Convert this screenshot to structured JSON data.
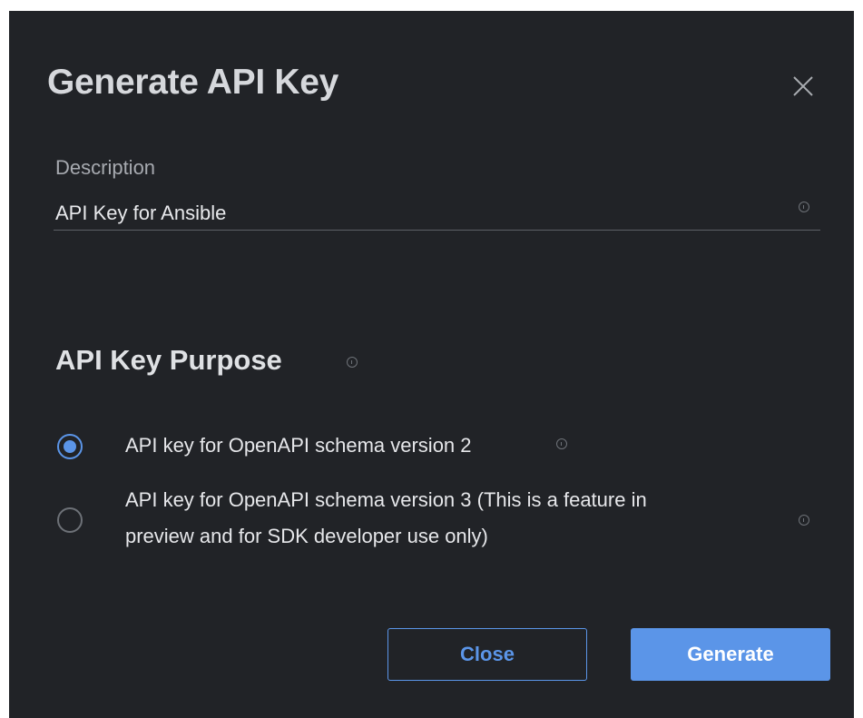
{
  "dialog": {
    "title": "Generate API Key",
    "close_icon": "close-icon"
  },
  "description": {
    "label": "Description",
    "value": "API Key for Ansible",
    "info_icon": "info-icon"
  },
  "purpose": {
    "title": "API Key Purpose",
    "info_icon": "info-icon",
    "options": [
      {
        "label": "API key for OpenAPI schema version 2",
        "selected": true,
        "info_icon": "info-icon"
      },
      {
        "label_line1": "API key for OpenAPI schema version 3 (This is a feature in",
        "label_line2": "preview and for SDK developer use only)",
        "selected": false,
        "info_icon": "info-icon"
      }
    ]
  },
  "buttons": {
    "close_label": "Close",
    "generate_label": "Generate"
  },
  "colors": {
    "background": "#212327",
    "accent": "#5b95e8",
    "text": "#e6e7ea",
    "muted": "#a7aab0"
  }
}
